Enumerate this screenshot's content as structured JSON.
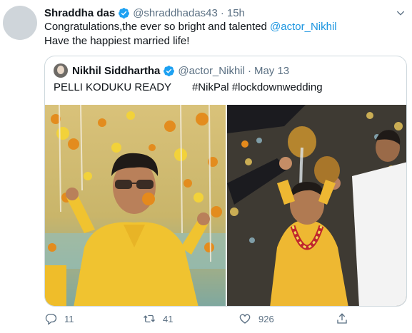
{
  "tweet": {
    "author_name": "Shraddha das",
    "handle": "@shraddhadas43",
    "separator": "·",
    "time": "15h",
    "text_line1_prefix": "Congratulations,the ever so bright and talented ",
    "text_line1_mention": "@actor_Nikhil",
    "text_line2": "Have the happiest married life!"
  },
  "quote": {
    "author_name": "Nikhil Siddhartha",
    "handle": "@actor_Nikhil",
    "separator": "·",
    "date": "May 13",
    "text": "PELLI KODUKU READY       #NikPal #lockdownwedding"
  },
  "actions": {
    "reply_count": "11",
    "retweet_count": "41",
    "like_count": "926"
  },
  "colors": {
    "accent": "#1b95e0",
    "muted": "#5b7083"
  },
  "icons": [
    "caret-down-icon",
    "verified-badge-icon",
    "reply-icon",
    "retweet-icon",
    "like-icon",
    "share-icon"
  ]
}
